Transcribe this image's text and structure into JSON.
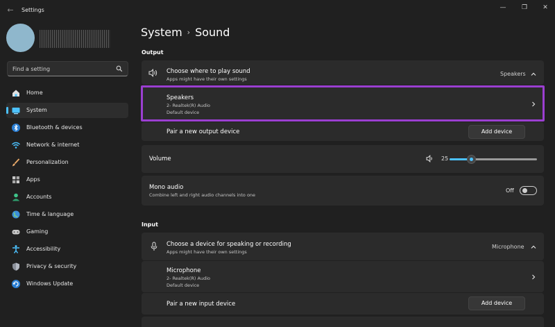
{
  "app": {
    "title": "Settings"
  },
  "window": {
    "minimize": "—",
    "maximize": "❐",
    "close": "✕"
  },
  "search": {
    "placeholder": "Find a setting"
  },
  "sidebar": {
    "items": [
      {
        "label": "Home",
        "icon": "home-icon",
        "selected": false
      },
      {
        "label": "System",
        "icon": "system-icon",
        "selected": true
      },
      {
        "label": "Bluetooth & devices",
        "icon": "bluetooth-icon",
        "selected": false
      },
      {
        "label": "Network & internet",
        "icon": "wifi-icon",
        "selected": false
      },
      {
        "label": "Personalization",
        "icon": "brush-icon",
        "selected": false
      },
      {
        "label": "Apps",
        "icon": "apps-icon",
        "selected": false
      },
      {
        "label": "Accounts",
        "icon": "accounts-icon",
        "selected": false
      },
      {
        "label": "Time & language",
        "icon": "globe-icon",
        "selected": false
      },
      {
        "label": "Gaming",
        "icon": "gamepad-icon",
        "selected": false
      },
      {
        "label": "Accessibility",
        "icon": "accessibility-icon",
        "selected": false
      },
      {
        "label": "Privacy & security",
        "icon": "shield-icon",
        "selected": false
      },
      {
        "label": "Windows Update",
        "icon": "update-icon",
        "selected": false
      }
    ]
  },
  "breadcrumb": {
    "parent": "System",
    "separator": "›",
    "current": "Sound"
  },
  "output": {
    "section_label": "Output",
    "choose": {
      "title": "Choose where to play sound",
      "subtitle": "Apps might have their own settings",
      "value": "Speakers"
    },
    "device": {
      "name": "Speakers",
      "driver": "2- Realtek(R) Audio",
      "status": "Default device"
    },
    "pair": {
      "label": "Pair a new output device",
      "button": "Add device"
    },
    "volume": {
      "label": "Volume",
      "value": "25",
      "level": 0.25
    },
    "mono": {
      "title": "Mono audio",
      "subtitle": "Combine left and right audio channels into one",
      "state": "Off"
    }
  },
  "input": {
    "section_label": "Input",
    "choose": {
      "title": "Choose a device for speaking or recording",
      "subtitle": "Apps might have their own settings",
      "value": "Microphone"
    },
    "device": {
      "name": "Microphone",
      "driver": "2- Realtek(R) Audio",
      "status": "Default device"
    },
    "pair": {
      "label": "Pair a new input device",
      "button": "Add device"
    }
  },
  "colors": {
    "accent": "#4cc2ff",
    "highlight": "#9b3fd1",
    "background": "#202020",
    "card": "#2b2b2b"
  }
}
